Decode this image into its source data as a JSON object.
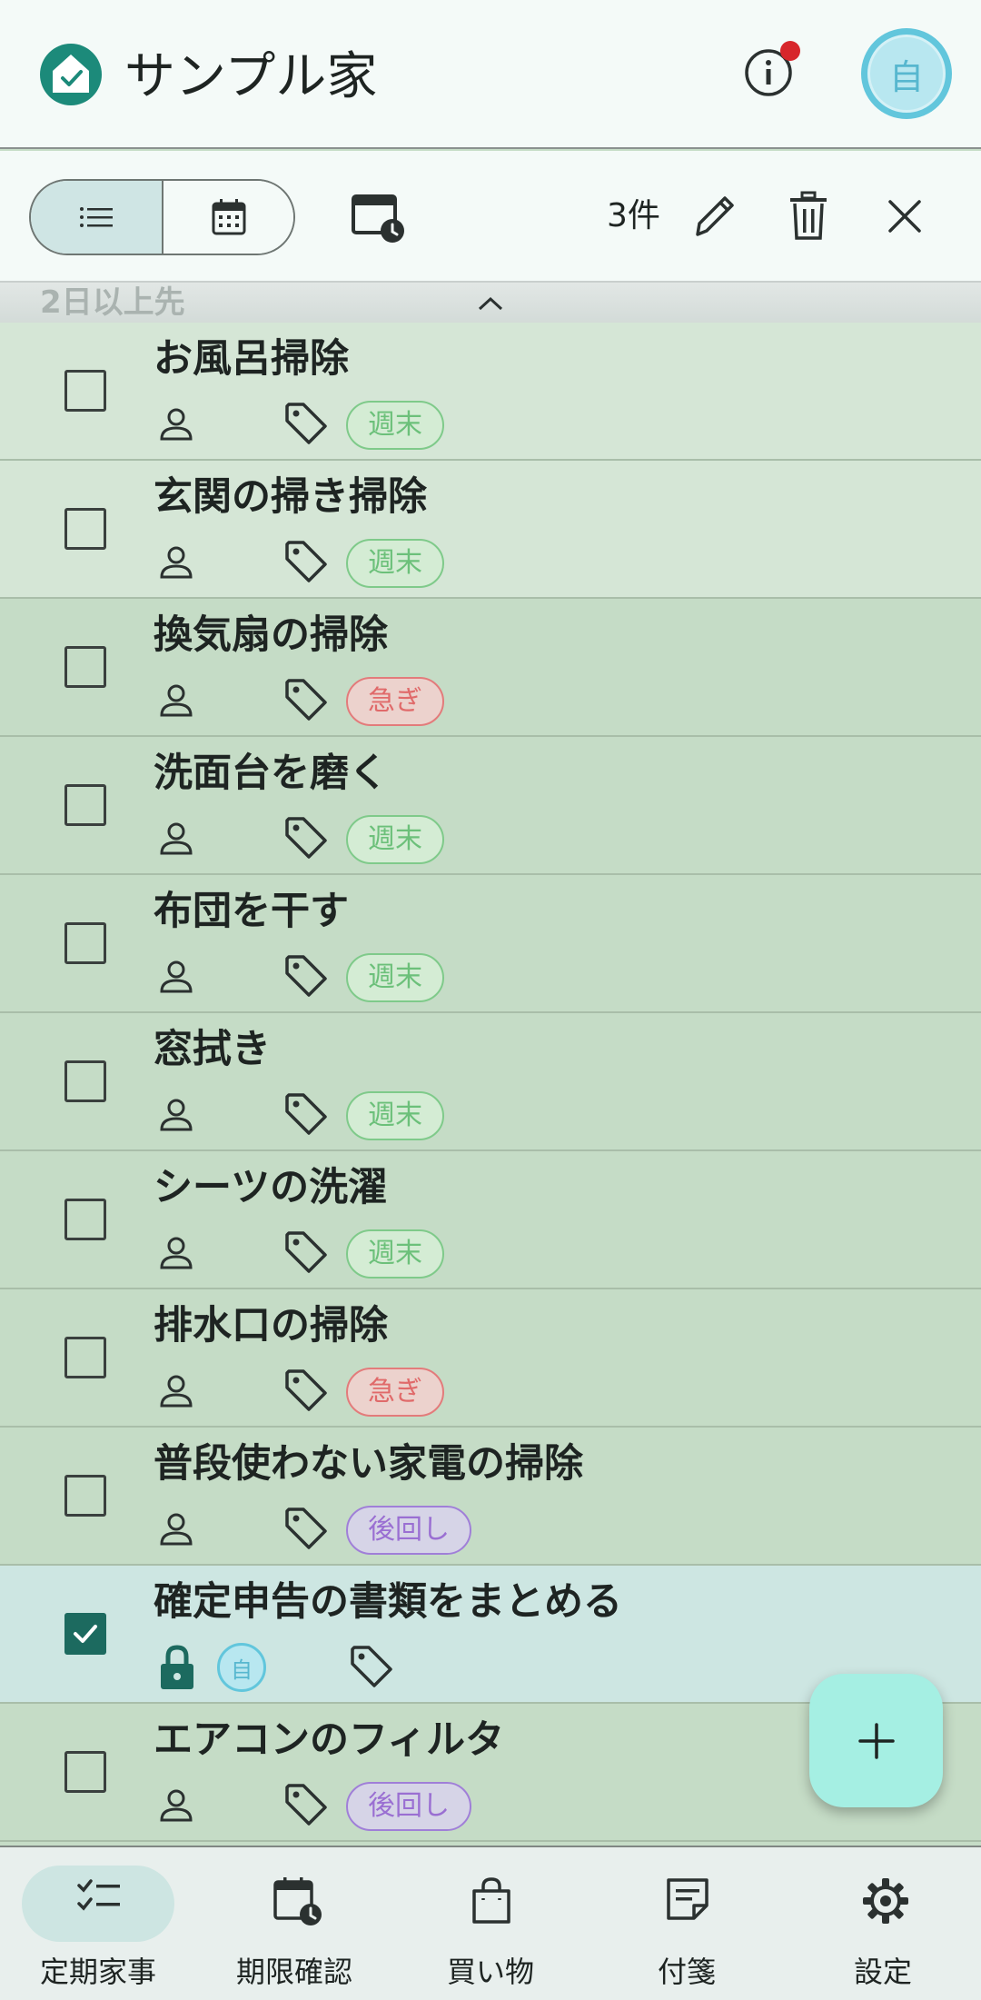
{
  "app": {
    "title": "サンプル家",
    "avatar_letter": "自"
  },
  "toolbar": {
    "count_label": "3件"
  },
  "section": {
    "label": "2日以上先"
  },
  "tasks": [
    {
      "title": "お風呂掃除",
      "tag": "週末",
      "tag_color": "green",
      "checked": false
    },
    {
      "title": "玄関の掃き掃除",
      "tag": "週末",
      "tag_color": "green",
      "checked": false
    },
    {
      "title": "換気扇の掃除",
      "tag": "急ぎ",
      "tag_color": "red",
      "checked": false
    },
    {
      "title": "洗面台を磨く",
      "tag": "週末",
      "tag_color": "green",
      "checked": false
    },
    {
      "title": "布団を干す",
      "tag": "週末",
      "tag_color": "green",
      "checked": false
    },
    {
      "title": "窓拭き",
      "tag": "週末",
      "tag_color": "green",
      "checked": false
    },
    {
      "title": "シーツの洗濯",
      "tag": "週末",
      "tag_color": "green",
      "checked": false
    },
    {
      "title": "排水口の掃除",
      "tag": "急ぎ",
      "tag_color": "red",
      "checked": false
    },
    {
      "title": "普段使わない家電の掃除",
      "tag": "後回し",
      "tag_color": "purple",
      "checked": false
    },
    {
      "title": "確定申告の書類をまとめる",
      "tag": "",
      "tag_color": "",
      "checked": true,
      "locked": true,
      "assignee": "自"
    },
    {
      "title": "エアコンのフィルタ",
      "tag": "後回し",
      "tag_color": "purple",
      "checked": false
    }
  ],
  "nav": [
    {
      "label": "定期家事",
      "icon": "checklist-icon",
      "active": true
    },
    {
      "label": "期限確認",
      "icon": "calendar-clock-icon",
      "active": false
    },
    {
      "label": "買い物",
      "icon": "shopping-bag-icon",
      "active": false
    },
    {
      "label": "付箋",
      "icon": "sticky-note-icon",
      "active": false
    },
    {
      "label": "設定",
      "icon": "gear-icon",
      "active": false
    }
  ],
  "colors": {
    "primary": "#1c6a5f",
    "accent": "#a5efe3",
    "tag_green": "#6cc07a",
    "tag_red": "#e06a6a",
    "tag_purple": "#9a6fd2",
    "notification": "#d7262b"
  }
}
